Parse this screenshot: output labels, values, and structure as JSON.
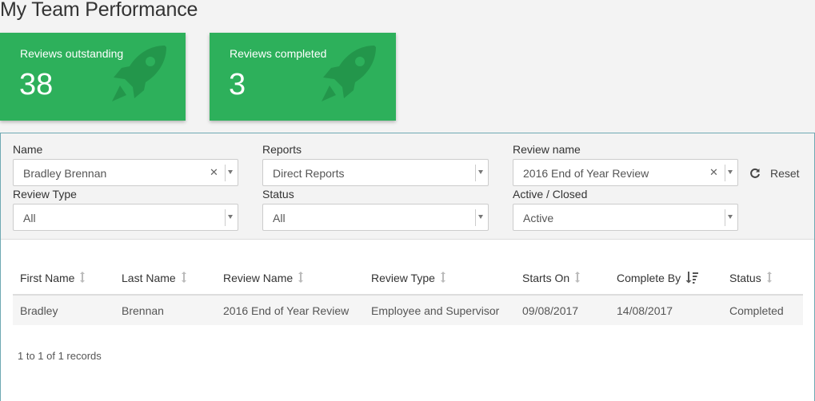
{
  "page_title": "My Team Performance",
  "cards": [
    {
      "label": "Reviews outstanding",
      "value": "38",
      "icon": "rocket-icon"
    },
    {
      "label": "Reviews completed",
      "value": "3",
      "icon": "rocket-icon"
    }
  ],
  "filters": {
    "name": {
      "label": "Name",
      "value": "Bradley Brennan"
    },
    "reports": {
      "label": "Reports",
      "value": "Direct Reports"
    },
    "review_name": {
      "label": "Review name",
      "value": "2016 End of Year Review"
    },
    "review_type": {
      "label": "Review Type",
      "value": "All"
    },
    "status": {
      "label": "Status",
      "value": "All"
    },
    "active_closed": {
      "label": "Active / Closed",
      "value": "Active"
    },
    "reset_label": "Reset"
  },
  "table": {
    "columns": [
      "First Name",
      "Last Name",
      "Review Name",
      "Review Type",
      "Starts On",
      "Complete By",
      "Status"
    ],
    "rows": [
      [
        "Bradley",
        "Brennan",
        "2016 End of Year Review",
        "Employee and Supervisor",
        "09/08/2017",
        "14/08/2017",
        "Completed"
      ]
    ]
  },
  "records_text": "1 to 1 of 1 records",
  "colors": {
    "card_green": "#2db05b",
    "rocket_shade": "#23964b",
    "panel_border": "#6fa9b3"
  }
}
